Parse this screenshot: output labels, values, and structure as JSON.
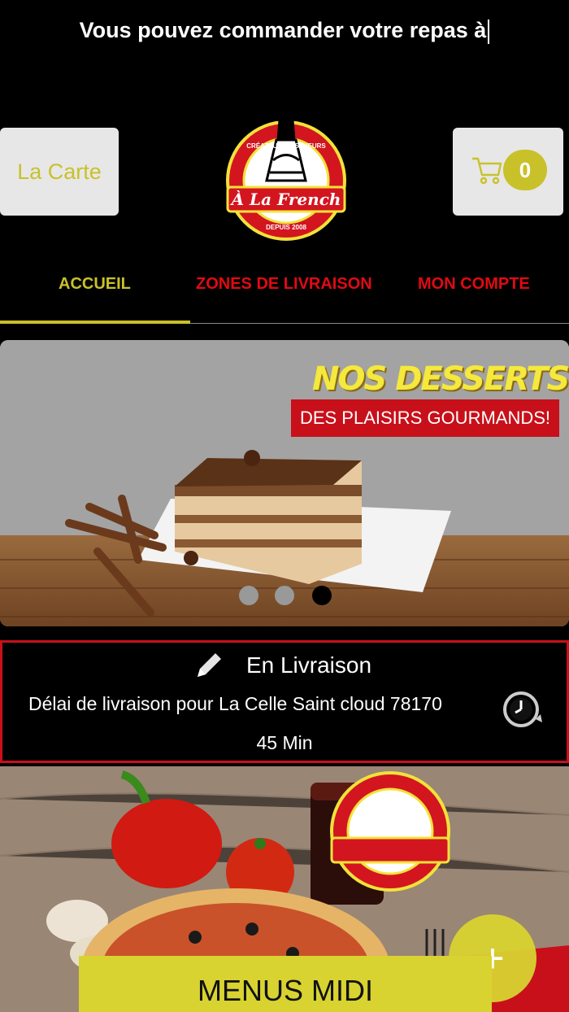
{
  "header": {
    "marquee_text": "Vous pouvez commander votre repas à",
    "menu_button_label": "La Carte",
    "cart_count": "0",
    "logo": {
      "top_text": "CRÉATEUR DE SAVEURS",
      "brand": "À La French",
      "bottom_text": "DEPUIS 2008"
    }
  },
  "nav": {
    "tabs": [
      {
        "label": "ACCUEIL",
        "active": true
      },
      {
        "label": "ZONES DE LIVRAISON",
        "active": false
      },
      {
        "label": "MON COMPTE",
        "active": false
      }
    ]
  },
  "banner": {
    "title": "NOS DESSERTS",
    "subtitle": "DES PLAISIRS GOURMANDS!",
    "slide_count": 3,
    "active_slide": 3
  },
  "delivery": {
    "mode": "En Livraison",
    "text": "Délai de livraison pour La Celle Saint cloud 78170",
    "time": "45 Min"
  },
  "category": {
    "label": "MENUS MIDI",
    "fab_symbol": "+"
  },
  "colors": {
    "accent": "#c9c12a",
    "red": "#e10a13",
    "background": "#000000"
  }
}
